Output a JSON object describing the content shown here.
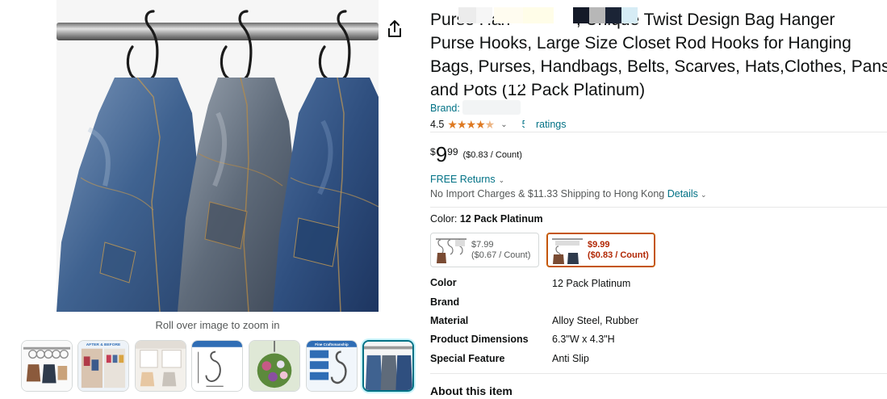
{
  "gallery": {
    "zoom_hint": "Roll over image to zoom in",
    "main_image_icon": "jeans-on-hooks-photo",
    "share_icon": "share-icon",
    "thumbnails": [
      {
        "icon": "hooks-with-bags-thumb",
        "selected": false
      },
      {
        "icon": "before-after-thumb",
        "caption": "AFTER & BEFORE",
        "selected": false
      },
      {
        "icon": "closet-use-thumb",
        "selected": false
      },
      {
        "icon": "dimensions-thumb",
        "selected": false
      },
      {
        "icon": "hanging-plant-thumb",
        "selected": false
      },
      {
        "icon": "fine-craftsmanship-thumb",
        "caption": "Fine Craftsmanship",
        "selected": false
      },
      {
        "icon": "jeans-on-hooks-thumb",
        "selected": true
      }
    ]
  },
  "product": {
    "title_line1": "Purse Han              , Unique Twist Design Bag Hanger",
    "title_rest": "Purse Hooks, Large Size Closet Rod Hooks for Hanging Bags, Purses, Handbags, Belts, Scarves, Hats,Clothes, Pans and Pots (12 Pack Platinum)",
    "brand_label": "Brand:",
    "rating_value": "4.5",
    "ratings_count": "58 ratings",
    "price": {
      "symbol": "$",
      "whole": "9",
      "fraction": "99",
      "unit": "($0.83 / Count)"
    },
    "returns": "FREE Returns",
    "shipping_text": "No Import Charges & $11.33 Shipping to Hong Kong",
    "shipping_link": "Details",
    "color_label": "Color:",
    "color_value": "12 Pack Platinum",
    "swatches": [
      {
        "price": "$7.99",
        "unit": "($0.67 / Count)",
        "selected": false
      },
      {
        "price": "$9.99",
        "unit": "($0.83 / Count)",
        "selected": true
      }
    ],
    "specs": [
      {
        "key": "Color",
        "value": "12 Pack Platinum"
      },
      {
        "key": "Brand",
        "value": ""
      },
      {
        "key": "Material",
        "value": "Alloy Steel, Rubber"
      },
      {
        "key": "Product Dimensions",
        "value": "6.3\"W x 4.3\"H"
      },
      {
        "key": "Special Feature",
        "value": "Anti Slip"
      }
    ],
    "about_heading": "About this item"
  },
  "colors": {
    "link": "#007185",
    "star": "#de7921",
    "price_red": "#b12704",
    "selected_border": "#c45500"
  }
}
